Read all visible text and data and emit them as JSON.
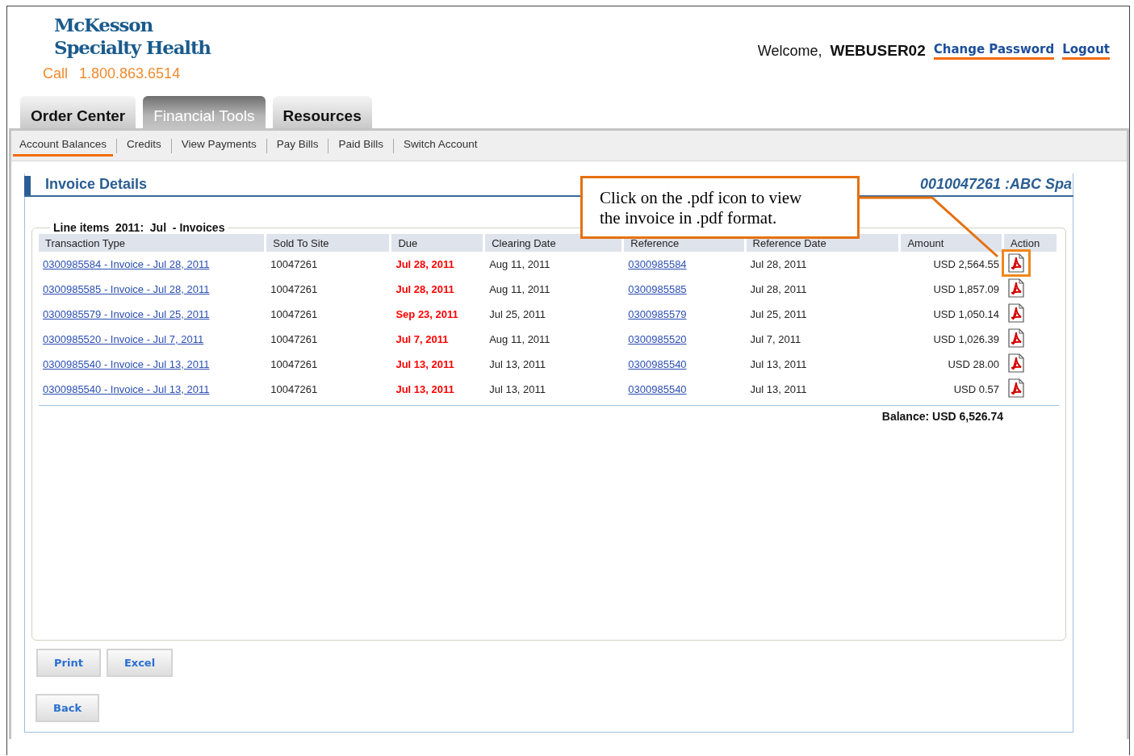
{
  "brand": {
    "logo_line_1": "McKesson",
    "logo_line_2": "Specialty Health",
    "call_label": "Call",
    "phone": "1.800.863.6514"
  },
  "user_bar": {
    "welcome": "Welcome,",
    "username": "WEBUSER02",
    "links": [
      "Change Password",
      "Logout"
    ]
  },
  "tabs": [
    {
      "label": "Order Center",
      "selected": false
    },
    {
      "label": "Financial Tools",
      "selected": true
    },
    {
      "label": "Resources",
      "selected": false
    }
  ],
  "subnav": [
    {
      "label": "Account Balances",
      "selected": true
    },
    {
      "label": "Credits",
      "selected": false
    },
    {
      "label": "View Payments",
      "selected": false
    },
    {
      "label": "Pay Bills",
      "selected": false
    },
    {
      "label": "Paid Bills",
      "selected": false
    },
    {
      "label": "Switch Account",
      "selected": false
    }
  ],
  "page_title": "Invoice Details",
  "account": "0010047261 :ABC Spa",
  "legend": "Line items  2011:  Jul  - Invoices",
  "table": {
    "columns": [
      "Transaction Type",
      "Sold To Site",
      "Due",
      "Clearing Date",
      "Reference",
      "Reference Date",
      "Amount",
      "Action"
    ],
    "rows": [
      {
        "transaction": "0300985584 - Invoice - Jul 28, 2011",
        "sold_to": "10047261",
        "due": "Jul 28, 2011",
        "clearing": "Aug 11, 2011",
        "reference": "0300985584",
        "reference_date": "Jul 28, 2011",
        "amount": "USD 2,564.55",
        "highlighted": true
      },
      {
        "transaction": "0300985585 - Invoice - Jul 28, 2011",
        "sold_to": "10047261",
        "due": "Jul 28, 2011",
        "clearing": "Aug 11, 2011",
        "reference": "0300985585",
        "reference_date": "Jul 28, 2011",
        "amount": "USD 1,857.09",
        "highlighted": false
      },
      {
        "transaction": "0300985579 - Invoice - Jul 25, 2011",
        "sold_to": "10047261",
        "due": "Sep 23, 2011",
        "clearing": "Jul 25, 2011",
        "reference": "0300985579",
        "reference_date": "Jul 25, 2011",
        "amount": "USD 1,050.14",
        "highlighted": false
      },
      {
        "transaction": "0300985520 - Invoice - Jul 7, 2011",
        "sold_to": "10047261",
        "due": "Jul 7, 2011",
        "clearing": "Aug 11, 2011",
        "reference": "0300985520",
        "reference_date": "Jul 7, 2011",
        "amount": "USD 1,026.39",
        "highlighted": false
      },
      {
        "transaction": "0300985540 - Invoice - Jul 13, 2011",
        "sold_to": "10047261",
        "due": "Jul 13, 2011",
        "clearing": "Jul 13, 2011",
        "reference": "0300985540",
        "reference_date": "Jul 13, 2011",
        "amount": "USD 28.00",
        "highlighted": false
      },
      {
        "transaction": "0300985540 - Invoice - Jul 13, 2011",
        "sold_to": "10047261",
        "due": "Jul 13, 2011",
        "clearing": "Jul 13, 2011",
        "reference": "0300985540",
        "reference_date": "Jul 13, 2011",
        "amount": "USD 0.57",
        "highlighted": false
      }
    ],
    "balance": "Balance: USD 6,526.74"
  },
  "buttons": [
    "Print",
    "Excel"
  ],
  "back_button": "Back",
  "callout": "Click on the .pdf icon to view the invoice in .pdf format."
}
